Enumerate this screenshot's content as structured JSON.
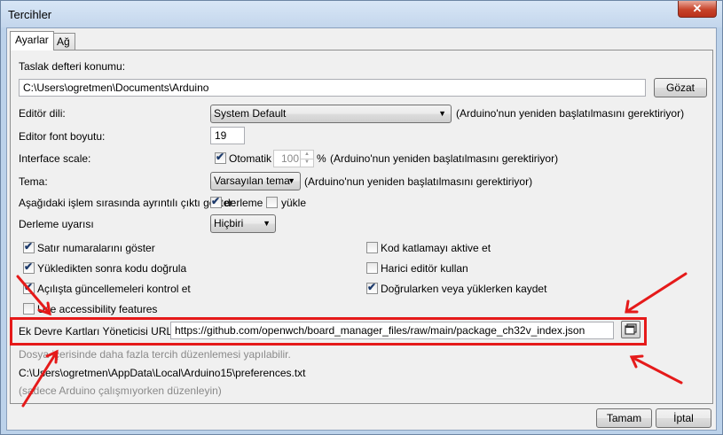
{
  "window": {
    "title": "Tercihler",
    "close_glyph": "✕"
  },
  "tabs": [
    {
      "label": "Ayarlar",
      "active": true
    },
    {
      "label": "Ağ",
      "active": false
    }
  ],
  "sketchbook": {
    "label": "Taslak defteri konumu:",
    "value": "C:\\Users\\ogretmen\\Documents\\Arduino",
    "browse_button": "Gözat"
  },
  "editor_language": {
    "label": "Editör dili:",
    "value": "System Default",
    "note": "(Arduino'nun yeniden başlatılmasını gerektiriyor)"
  },
  "editor_font": {
    "label": "Editor font boyutu:",
    "value": "19"
  },
  "interface_scale": {
    "label": "Interface scale:",
    "auto_label": "Otomatik",
    "auto_checked": true,
    "value": "100",
    "percent": "%",
    "note": "(Arduino'nun yeniden başlatılmasını gerektiriyor)"
  },
  "theme": {
    "label": "Tema:",
    "value": "Varsayılan tema",
    "note": "(Arduino'nun yeniden başlatılmasını gerektiriyor)"
  },
  "verbose": {
    "label": "Aşağıdaki işlem sırasında ayrıntılı çıktı göster:",
    "compile_label": "derleme",
    "compile_checked": true,
    "upload_label": "yükle",
    "upload_checked": false
  },
  "warnings": {
    "label": "Derleme uyarısı",
    "value": "Hiçbiri"
  },
  "options_left": [
    {
      "label": "Satır numaralarını göster",
      "checked": true
    },
    {
      "label": "Yükledikten sonra kodu doğrula",
      "checked": true
    },
    {
      "label": "Açılışta güncellemeleri kontrol et",
      "checked": true
    },
    {
      "label": "Use accessibility features",
      "checked": false
    }
  ],
  "options_right": [
    {
      "label": "Kod katlamayı aktive et",
      "checked": false
    },
    {
      "label": "Harici editör kullan",
      "checked": false
    },
    {
      "label": "Doğrularken veya yüklerken kaydet",
      "checked": true
    }
  ],
  "boards_url": {
    "label": "Ek Devre Kartları Yöneticisi URL'leri:",
    "value": "https://github.com/openwch/board_manager_files/raw/main/package_ch32v_index.json"
  },
  "info": {
    "more_prefs": "Dosya içerisinde daha fazla tercih düzenlemesi yapılabilir.",
    "prefs_path": "C:\\Users\\ogretmen\\AppData\\Local\\Arduino15\\preferences.txt",
    "edit_note": "(sadece Arduino çalışmıyorken düzenleyin)"
  },
  "footer": {
    "ok_button": "Tamam",
    "cancel_button": "İptal"
  },
  "colors": {
    "highlight": "#e51a1a",
    "window_frame": "#bcd2ea",
    "panel": "#f0f0f0"
  },
  "icons": {
    "checkmark": "✔",
    "dropdown_arrow": "▼",
    "spin_up": "▲",
    "spin_down": "▼"
  }
}
